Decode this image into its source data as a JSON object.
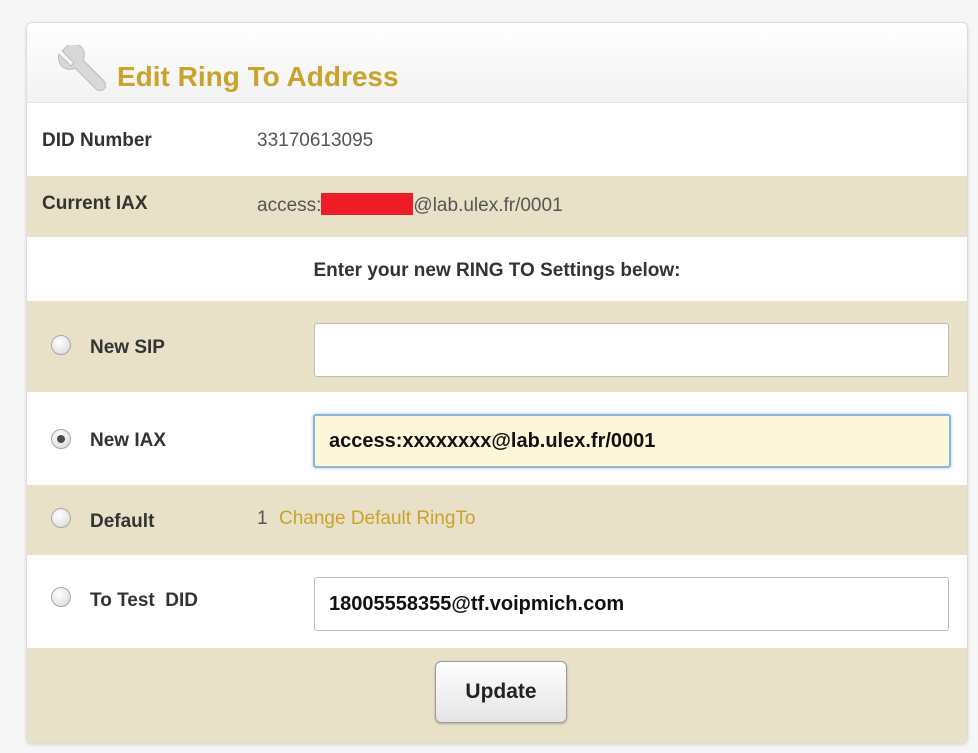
{
  "header": {
    "title": "Edit Ring To Address",
    "icon": "wrench-icon"
  },
  "colors": {
    "accent": "#c9a32c",
    "row_alt": "#e8e1c8",
    "redaction": "#ee1c25"
  },
  "did": {
    "label": "DID Number",
    "value": "33170613095"
  },
  "current_iax": {
    "label": "Current IAX",
    "value_prefix": "access:",
    "value_suffix": "@lab.ulex.fr/0001"
  },
  "instructions": "Enter your new RING TO Settings below:",
  "options": {
    "new_sip": {
      "label": "New SIP",
      "value": "",
      "checked": false
    },
    "new_iax": {
      "label": "New IAX",
      "value": "access:xxxxxxxx@lab.ulex.fr/0001",
      "checked": true
    },
    "default": {
      "label": "Default",
      "value": "1",
      "link": "Change Default RingTo",
      "checked": false
    },
    "test_did": {
      "label": "To Test  DID",
      "value": "18005558355@tf.voipmich.com",
      "checked": false
    }
  },
  "update_button": "Update"
}
